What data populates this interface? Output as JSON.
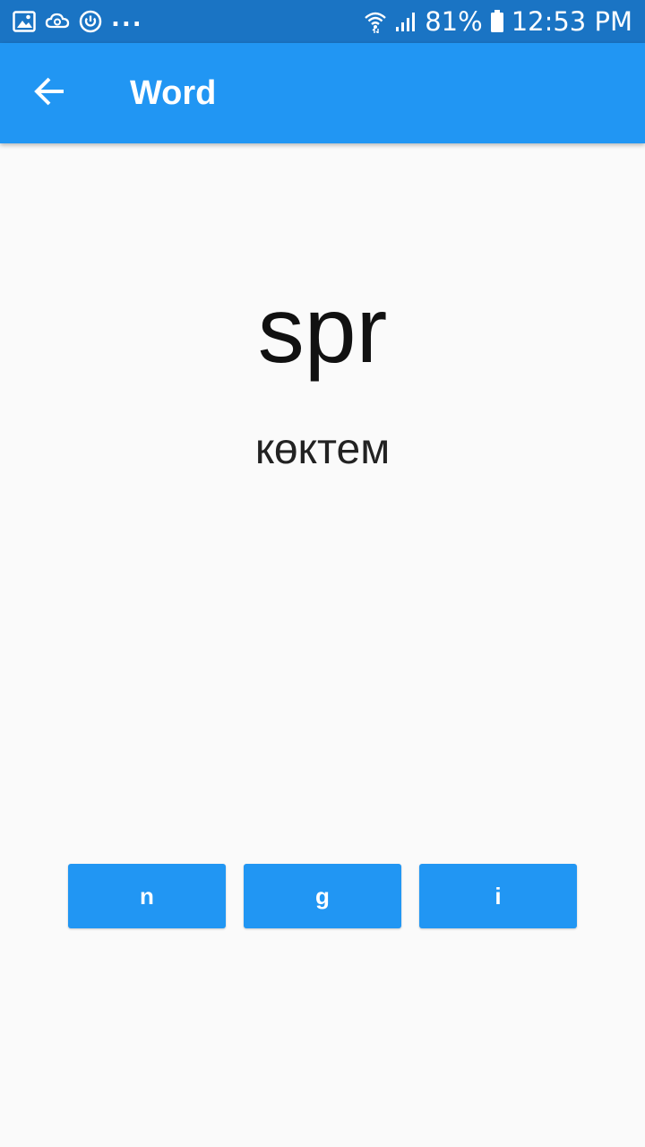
{
  "status_bar": {
    "left_icons": [
      "image-icon",
      "cloud-sync-icon",
      "power-ring-icon"
    ],
    "overflow": "...",
    "battery_percent": "81%",
    "time": "12:53 PM",
    "icon_color": "#ffffff",
    "background": "#1a74c4"
  },
  "app_bar": {
    "title": "Word",
    "back_icon": "arrow-left-icon",
    "background": "#2196f3"
  },
  "word": {
    "text": "spr",
    "translation": "көктем"
  },
  "options": [
    {
      "label": "n"
    },
    {
      "label": "g"
    },
    {
      "label": "i"
    }
  ],
  "accent": "#2196f3"
}
